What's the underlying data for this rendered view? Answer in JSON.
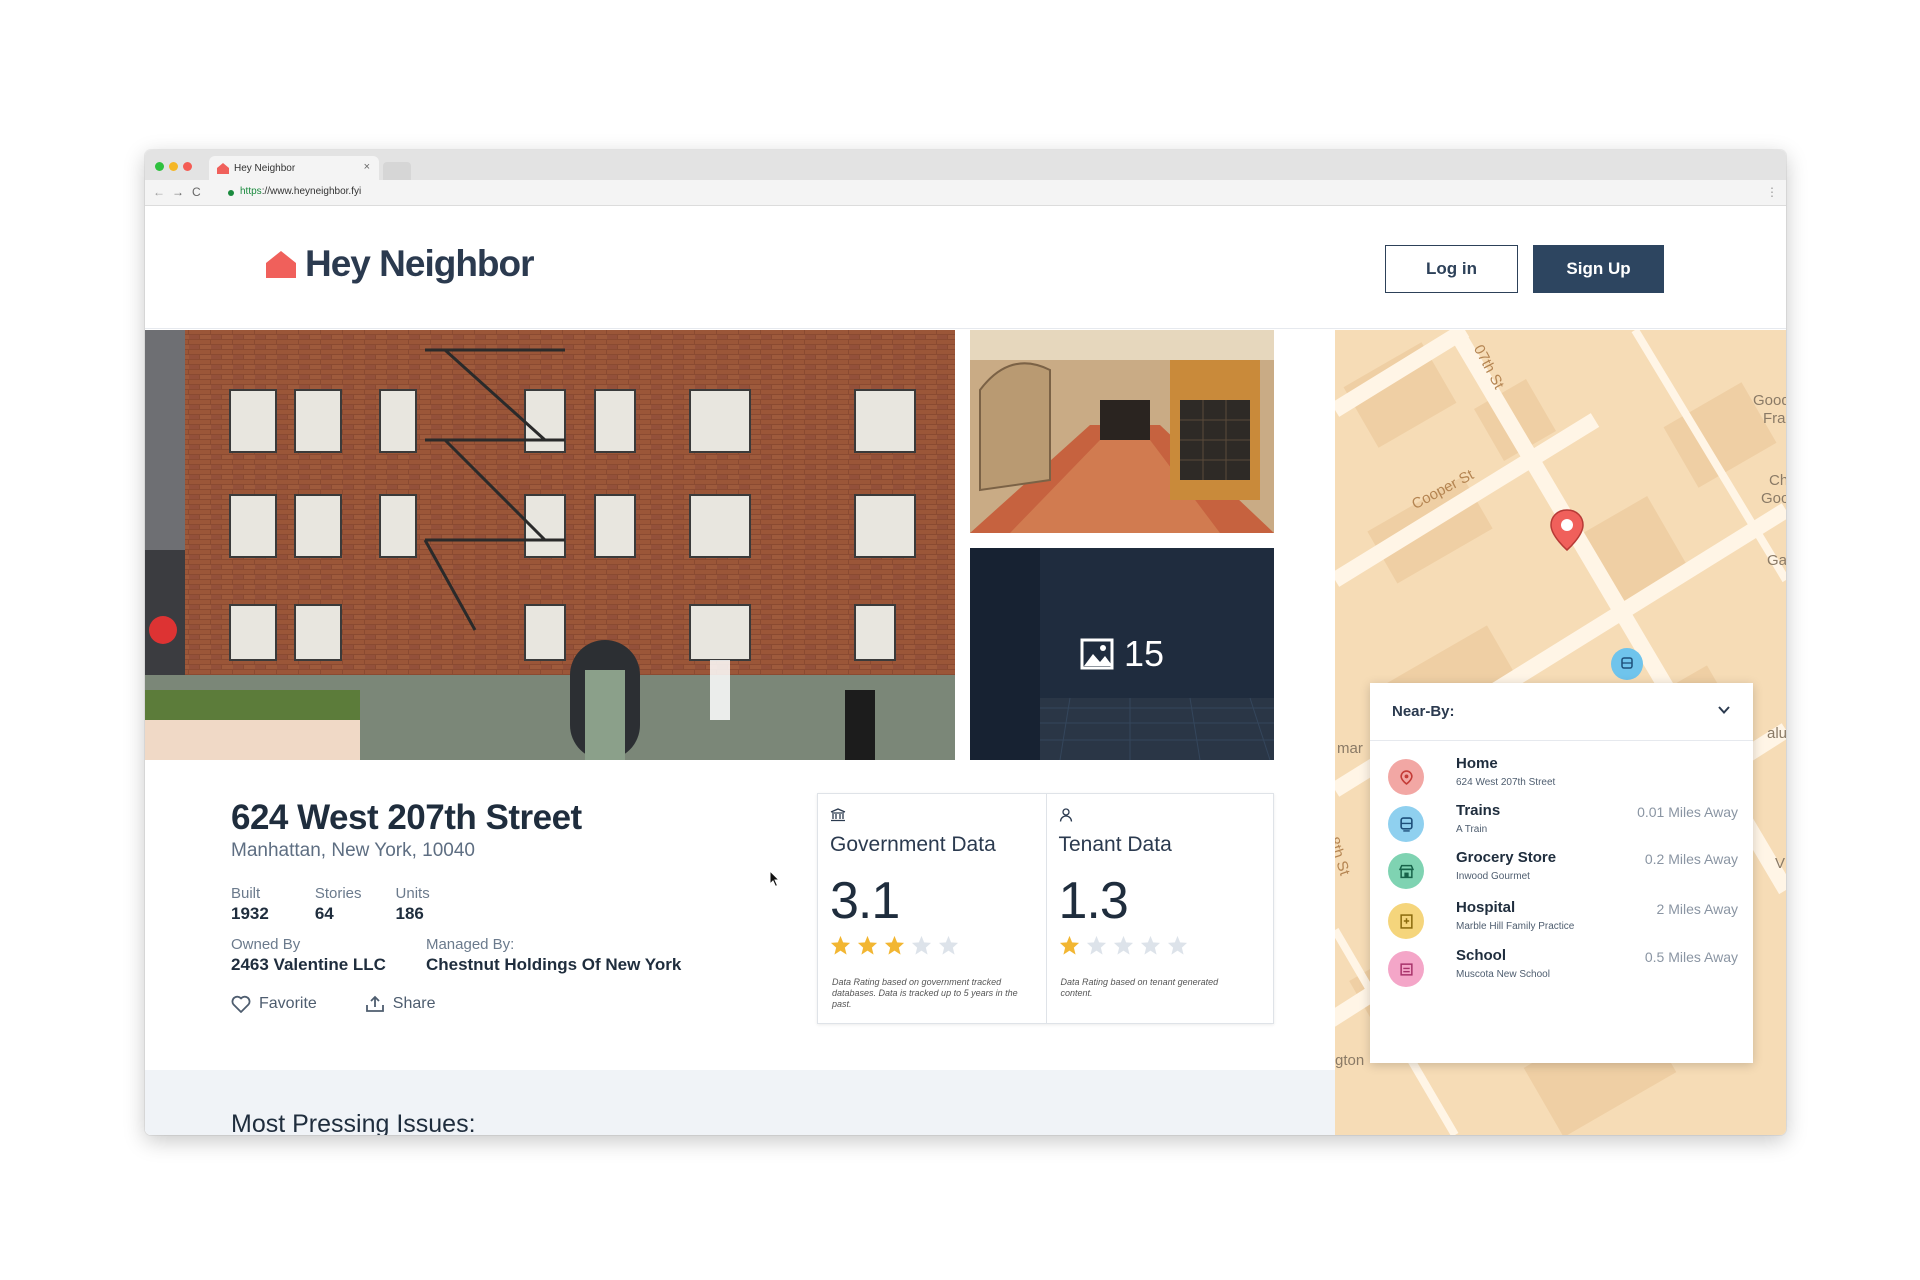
{
  "browser": {
    "tab_title": "Hey Neighbor",
    "tab_close": "×",
    "url_scheme": "https",
    "url_rest": "://www.heyneighbor.fyi",
    "back_glyph": "←",
    "forward_glyph": "→",
    "reload_glyph": "C",
    "menu_glyph": "⋮"
  },
  "header": {
    "logo_text": "Hey Neighbor",
    "login_label": "Log in",
    "signup_label": "Sign Up",
    "brand_color": "#f0605b"
  },
  "gallery": {
    "photo_count": "15"
  },
  "building": {
    "address": "624 West 207th Street",
    "city": "Manhattan, New York, 10040",
    "built_label": "Built",
    "built_value": "1932",
    "stories_label": "Stories",
    "stories_value": "64",
    "units_label": "Units",
    "units_value": "186",
    "owned_label": "Owned By",
    "owned_value": "2463 Valentine LLC",
    "managed_label": "Managed By:",
    "managed_value": "Chestnut Holdings Of New York",
    "favorite_label": "Favorite",
    "share_label": "Share"
  },
  "ratings": {
    "government": {
      "title": "Government Data",
      "score": "3.1",
      "stars_filled": 3,
      "stars_total": 5,
      "note": "Data Rating based on government tracked databases. Data is tracked up to 5 years in the past."
    },
    "tenant": {
      "title": "Tenant Data",
      "score": "1.3",
      "stars_filled": 1,
      "stars_total": 5,
      "note": "Data Rating based on tenant generated content."
    }
  },
  "issues": {
    "title": "Most Pressing Issues:"
  },
  "map": {
    "labels": [
      "Cooper St"
    ],
    "partial_labels": [
      "07th St",
      "Good",
      "Fra",
      "Ch",
      "Goo",
      "Ga",
      "mar",
      "alup",
      "8th St",
      "gton",
      "V"
    ]
  },
  "nearby": {
    "title": "Near-By:",
    "items": [
      {
        "name": "Home",
        "detail": "624 West 207th Street",
        "distance": "",
        "color": "#f2a7a4",
        "icon": "pin-icon"
      },
      {
        "name": "Trains",
        "detail": "A Train",
        "distance": "0.01 Miles Away",
        "color": "#8fd0ef",
        "icon": "train-icon"
      },
      {
        "name": "Grocery Store",
        "detail": "Inwood Gourmet",
        "distance": "0.2 Miles Away",
        "color": "#7fd3b2",
        "icon": "store-icon"
      },
      {
        "name": "Hospital",
        "detail": "Marble Hill Family Practice",
        "distance": "2 Miles Away",
        "color": "#f5d57c",
        "icon": "hospital-icon"
      },
      {
        "name": "School",
        "detail": "Muscota New School",
        "distance": "0.5 Miles Away",
        "color": "#f4a6c8",
        "icon": "school-icon"
      }
    ]
  }
}
